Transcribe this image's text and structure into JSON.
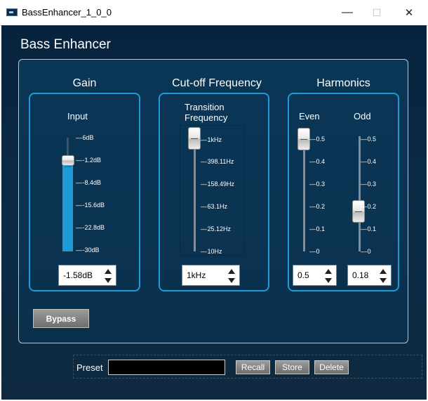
{
  "window": {
    "title": "BassEnhancer_1_0_0",
    "minimize_glyph": "—",
    "maximize_glyph": "☐",
    "close_glyph": "✕"
  },
  "app": {
    "title": "Bass Enhancer"
  },
  "gain": {
    "title": "Gain",
    "input_label": "Input",
    "ticks": [
      "6dB",
      "-1.2dB",
      "-8.4dB",
      "-15.6dB",
      "-22.8dB",
      "-30dB"
    ],
    "value": "-1.58dB",
    "range_db": [
      -30,
      6
    ],
    "level_db": -1.58
  },
  "cutoff": {
    "title": "Cut-off Frequency",
    "label": "Transition\nFrequency",
    "ticks": [
      "1kHz",
      "398.11Hz",
      "158.49Hz",
      "63.1Hz",
      "25.12Hz",
      "10Hz"
    ],
    "value": "1kHz"
  },
  "harmonics": {
    "title": "Harmonics",
    "even_label": "Even",
    "odd_label": "Odd",
    "even_ticks": [
      "0.5",
      "0.4",
      "0.3",
      "0.2",
      "0.1",
      "0"
    ],
    "odd_ticks": [
      "0.5",
      "0.4",
      "0.3",
      "0.2",
      "0.1",
      "0"
    ],
    "even_value": "0.5",
    "odd_value": "0.18"
  },
  "bypass_label": "Bypass",
  "preset": {
    "label": "Preset",
    "value": "",
    "recall_label": "Recall",
    "store_label": "Store",
    "delete_label": "Delete"
  },
  "colors": {
    "accent": "#1e9ad6",
    "background": "#0b2b47",
    "panel": "#0a3657"
  }
}
